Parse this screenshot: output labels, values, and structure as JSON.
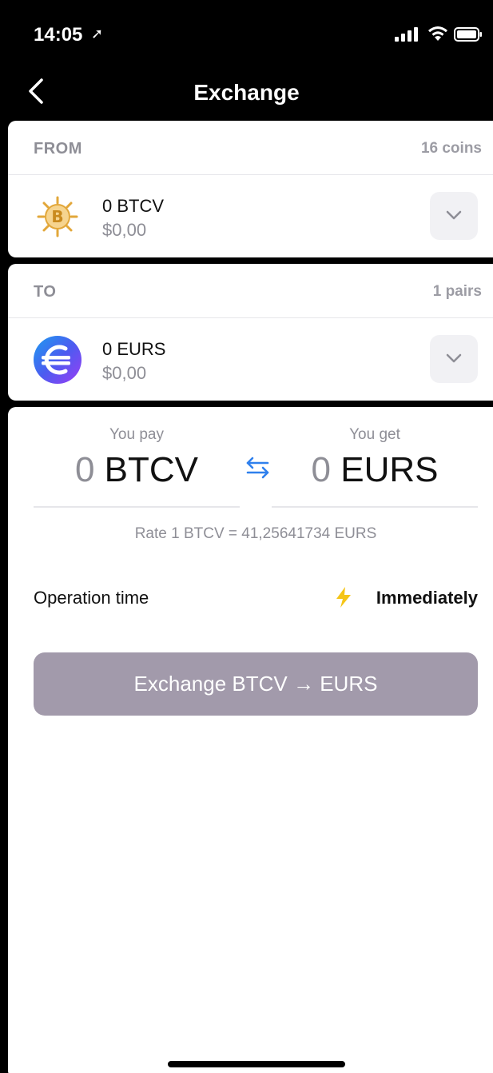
{
  "status_bar": {
    "time": "14:05"
  },
  "nav": {
    "title": "Exchange"
  },
  "from": {
    "label": "FROM",
    "count": "16 coins",
    "amount": "0 BTCV",
    "usd": "$0,00",
    "icon": "bitcoin-vault-coin-icon"
  },
  "to": {
    "label": "TO",
    "count": "1 pairs",
    "amount": "0 EURS",
    "usd": "$0,00",
    "icon": "eurs-coin-icon"
  },
  "exchange": {
    "pay_label": "You pay",
    "pay_value": "0",
    "pay_currency": "BTCV",
    "get_label": "You get",
    "get_value": "0",
    "get_currency": "EURS",
    "rate": "Rate 1 BTCV = 41,25641734 EURS",
    "operation_label": "Operation time",
    "operation_value": "Immediately",
    "button_label": "Exchange BTCV → EURS"
  },
  "colors": {
    "button": "#a29aab",
    "accent_blue": "#2f80ed",
    "bolt": "#f5c518",
    "btcv_gold": "#e2a73a"
  }
}
